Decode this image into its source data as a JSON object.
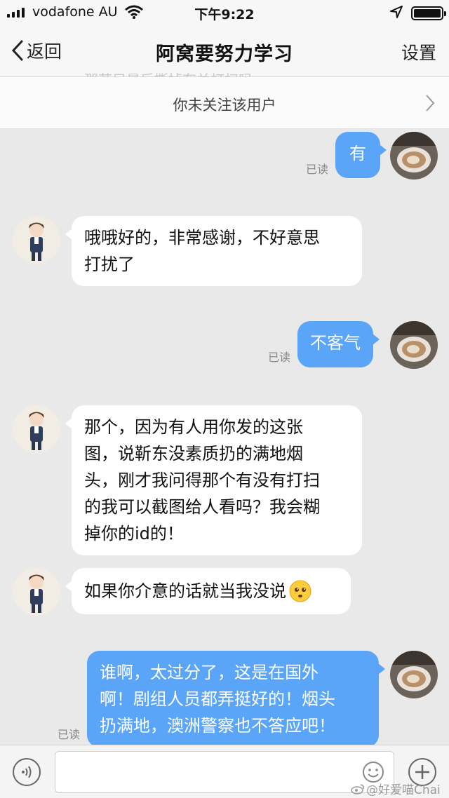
{
  "status_bar": {
    "carrier": "vodafone AU",
    "time": "下午9:22"
  },
  "nav": {
    "back_label": "返回",
    "title": "阿窝要努力学习",
    "settings_label": "设置",
    "ghost_text": "那若只最后撕掉有关打扫吗"
  },
  "follow_banner": {
    "text": "你未关注该用户"
  },
  "messages": [
    {
      "text": "有",
      "read": "已读"
    },
    {
      "text": "哦哦好的，非常感谢，不好意思\n打扰了"
    },
    {
      "text": "不客气",
      "read": "已读"
    },
    {
      "text": "那个，因为有人用你发的这张\n图，说靳东没素质扔的满地烟\n头，刚才我问得那个有没有打扫\n的我可以截图给人看吗？我会糊\n掉你的id的！"
    },
    {
      "text": "如果你介意的话就当我没说"
    },
    {
      "text": "谁啊，太过分了，这是在国外\n啊！剧组人员都弄挺好的！烟头\n扔满地，澳洲警察也不答应吧！",
      "read": "已读"
    }
  ],
  "watermark": "@好爱喵Chai",
  "colors": {
    "outgoing_bubble": "#5aa5f7",
    "incoming_bubble": "#ffffff",
    "background": "#e9e9e9"
  }
}
